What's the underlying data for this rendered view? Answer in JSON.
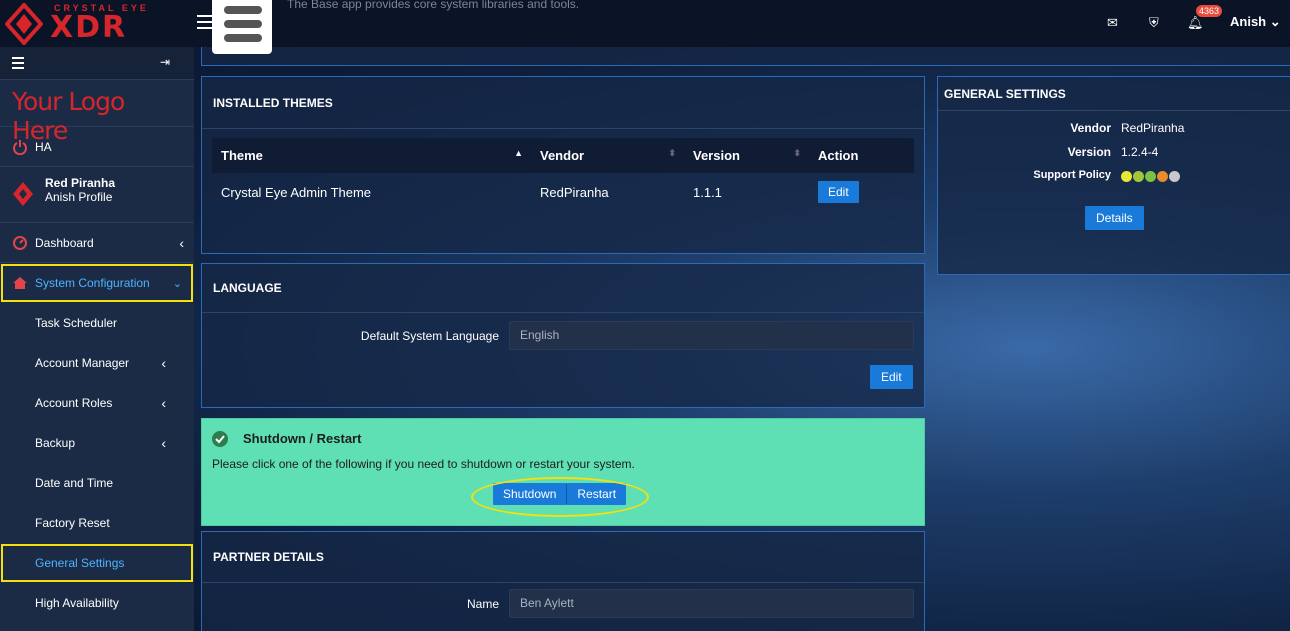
{
  "topbar": {
    "logo_small": "CRYSTAL EYE",
    "logo_big": "XDR",
    "app_desc": "The Base app provides core system libraries and tools.",
    "notif_count": "4363",
    "user": "Anish"
  },
  "sidebar": {
    "brand": "Your Logo Here",
    "ha": "HA",
    "profile_name": "Red Piranha",
    "profile_sub": "Anish Profile",
    "dashboard": "Dashboard",
    "system_config": "System Configuration",
    "items": [
      "Task Scheduler",
      "Account Manager",
      "Account Roles",
      "Backup",
      "Date and Time",
      "Factory Reset",
      "General Settings",
      "High Availability"
    ]
  },
  "themes": {
    "title": "INSTALLED THEMES",
    "headers": [
      "Theme",
      "Vendor",
      "Version",
      "Action"
    ],
    "row": {
      "theme": "Crystal Eye Admin Theme",
      "vendor": "RedPiranha",
      "version": "1.1.1",
      "action": "Edit"
    }
  },
  "language": {
    "title": "LANGUAGE",
    "label": "Default System Language",
    "value": "English",
    "edit": "Edit"
  },
  "shutdown": {
    "title": "Shutdown / Restart",
    "message": "Please click one of the following if you need to shutdown or restart your system.",
    "shutdown_btn": "Shutdown",
    "restart_btn": "Restart"
  },
  "partner": {
    "title": "PARTNER DETAILS",
    "name_label": "Name",
    "name_value": "Ben Aylett"
  },
  "general": {
    "title": "GENERAL SETTINGS",
    "vendor_label": "Vendor",
    "vendor": "RedPiranha",
    "version_label": "Version",
    "version": "1.2.4-4",
    "support_label": "Support Policy",
    "details_btn": "Details",
    "support_colors": [
      "#e8e832",
      "#a2c83a",
      "#7dc243",
      "#e88b2a",
      "#c8c8c8"
    ]
  }
}
